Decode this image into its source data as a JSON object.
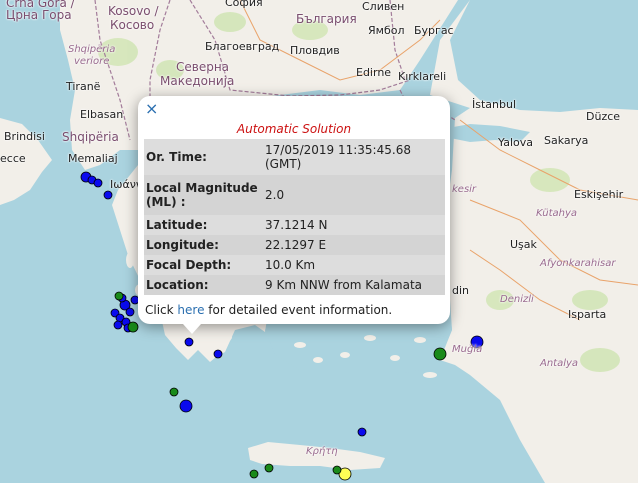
{
  "colors": {
    "sea": "#aad3df",
    "land": "#f2efe9",
    "green_area": "#cfe5b2",
    "border": "#a37c9a",
    "quake_blue": "#0a0aee",
    "quake_green": "#1a8a1a",
    "quake_yellow": "#ffff55",
    "popup_title": "#cc1111",
    "link": "#2a6fb0"
  },
  "map_labels": {
    "crna_gora_cut": "Crna Gora /",
    "crna_gora": "Црна Гора",
    "kosovo": "Kosovo /",
    "kosovo2": "Косово",
    "sofia": "София",
    "bulgaria": "България",
    "sliven": "Сливен",
    "blagoevgrad": "Благоевград",
    "plovdiv": "Пловдив",
    "yambol": "Ямбол",
    "burgas": "Бургас",
    "shqiperia_it": "Shqipëria",
    "veriore": "veriore",
    "severna": "Северна",
    "makedonija": "Македонија",
    "edirne": "Edirne",
    "kirklareli": "Kırklareli",
    "tirane": "Tiranë",
    "elbasan": "Elbasan",
    "brindisi": "Brindisi",
    "shqiperia": "Shqipëria",
    "lecce": "ecce",
    "memaliaj": "Memaliaj",
    "ioannina": "Ιωάννι",
    "istanbul": "İstanbul",
    "duzce": "Düzce",
    "yalova": "Yalova",
    "sakarya": "Sakarya",
    "kesir": "kesir",
    "kutahya": "Kütahya",
    "eskisehir": "Eskişehir",
    "usak": "Uşak",
    "afyonkarahisar": "Afyonkarahisar",
    "din": "din",
    "denizli": "Denizli",
    "isparta": "Isparta",
    "mugla": "Muğla",
    "antalya": "Antalya",
    "kriti": "Κρήτη"
  },
  "popup": {
    "close_symbol": "×",
    "title": "Automatic Solution",
    "rows": [
      {
        "label": "Or. Time:",
        "value": "17/05/2019 11:35:45.68 (GMT)"
      },
      {
        "label": "Local Magnitude (ML) :",
        "value": "2.0"
      },
      {
        "label": "Latitude:",
        "value": "37.1214 N"
      },
      {
        "label": "Longitude:",
        "value": "22.1297 E"
      },
      {
        "label": "Focal Depth:",
        "value": "10.0 Km"
      },
      {
        "label": "Location:",
        "value": "9 Km NNW from Kalamata"
      }
    ],
    "footer_prefix": "Click ",
    "footer_link": "here",
    "footer_suffix": " for detailed event information."
  },
  "events": {
    "count_shown": 37,
    "colors_legend": [
      "blue",
      "green",
      "yellow"
    ]
  }
}
